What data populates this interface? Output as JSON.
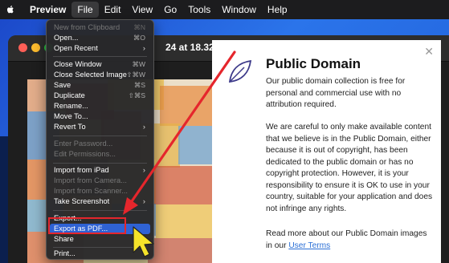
{
  "menubar": {
    "app_name": "Preview",
    "items": [
      "File",
      "Edit",
      "View",
      "Go",
      "Tools",
      "Window",
      "Help"
    ]
  },
  "window": {
    "title_fragment": "24 at 18.32.22"
  },
  "file_menu": {
    "items": [
      {
        "label": "New from Clipboard",
        "shortcut": "⌘N",
        "disabled": true
      },
      {
        "label": "Open...",
        "shortcut": "⌘O"
      },
      {
        "label": "Open Recent",
        "submenu": true
      },
      {
        "label": "Close Window",
        "shortcut": "⌘W"
      },
      {
        "label": "Close Selected Image",
        "shortcut": "⇧⌘W"
      },
      {
        "label": "Save",
        "shortcut": "⌘S"
      },
      {
        "label": "Duplicate",
        "shortcut": "⇧⌘S"
      },
      {
        "label": "Rename..."
      },
      {
        "label": "Move To..."
      },
      {
        "label": "Revert To",
        "submenu": true
      },
      {
        "label": "Enter Password...",
        "disabled": true
      },
      {
        "label": "Edit Permissions...",
        "disabled": true
      },
      {
        "label": "Import from iPad",
        "submenu": true
      },
      {
        "label": "Import from Camera...",
        "disabled": true
      },
      {
        "label": "Import from Scanner...",
        "disabled": true
      },
      {
        "label": "Take Screenshot",
        "submenu": true
      },
      {
        "label": "Export..."
      },
      {
        "label": "Export as PDF...",
        "highlighted": true
      },
      {
        "label": "Share"
      },
      {
        "label": "Print..."
      }
    ]
  },
  "info_panel": {
    "title": "Public Domain",
    "paragraph1": "Our public domain collection is free for personal and commercial use with no attribution required.",
    "paragraph2": "We are careful to only make available content that we believe is in the Public Domain, either because it is out of copyright, has been dedicated to the public domain or has no copyright protection. However, it is your responsibility to ensure it is OK to use in your country, suitable for your application and does not infringe any rights.",
    "paragraph3_start": "Read more about our Public Domain images in our",
    "paragraph3_link": "User Terms"
  },
  "colors": {
    "annotation_red": "#e5262c",
    "highlight_blue": "#2f62d4",
    "cursor_yellow": "#f5e32a"
  }
}
